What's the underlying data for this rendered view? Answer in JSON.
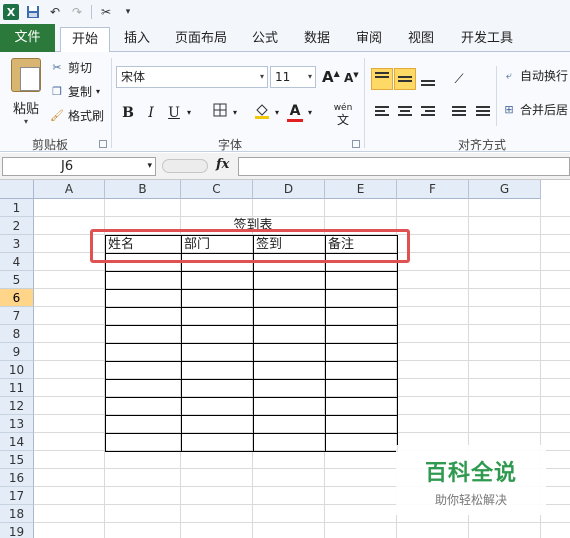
{
  "qat": {
    "app_icon": "excel-logo",
    "app_letter": "X",
    "save_icon": "save-icon",
    "undo_icon": "undo-icon",
    "redo_icon": "redo-icon",
    "tools_icon": "tools-icon",
    "customize_icon": "customize-icon"
  },
  "tabs": {
    "file": "文件",
    "home": "开始",
    "insert": "插入",
    "page_layout": "页面布局",
    "formulas": "公式",
    "data": "数据",
    "review": "审阅",
    "view": "视图",
    "developer": "开发工具"
  },
  "clipboard": {
    "paste": "粘贴",
    "cut": "剪切",
    "copy": "复制",
    "format_painter": "格式刷",
    "group_label": "剪贴板"
  },
  "font": {
    "font_name": "宋体",
    "font_size": "11",
    "grow": "A",
    "shrink": "A",
    "bold": "B",
    "italic": "I",
    "underline": "U",
    "phonetic": "wén",
    "group_label": "字体",
    "font_color": "A"
  },
  "alignment": {
    "wrap_text": "自动换行",
    "merge_center": "合并后居",
    "group_label": "对齐方式"
  },
  "formula_bar": {
    "name_box": "J6",
    "fx_label": "fx",
    "formula": ""
  },
  "sheet": {
    "columns": [
      "A",
      "B",
      "C",
      "D",
      "E",
      "F",
      "G"
    ],
    "rows": [
      "1",
      "2",
      "3",
      "4",
      "5",
      "6",
      "7",
      "8",
      "9",
      "10",
      "11",
      "12",
      "13",
      "14",
      "15",
      "16",
      "17",
      "18",
      "19"
    ],
    "selected_row": "6",
    "title": "签到表",
    "headers": [
      "姓名",
      "部门",
      "签到",
      "备注"
    ]
  },
  "watermark": {
    "line1": "百科全说",
    "line2": "助你轻松解决"
  },
  "colors": {
    "accent_green": "#2b7a3b",
    "highlight_red": "#e05252",
    "selected_row": "#ffd58a"
  }
}
